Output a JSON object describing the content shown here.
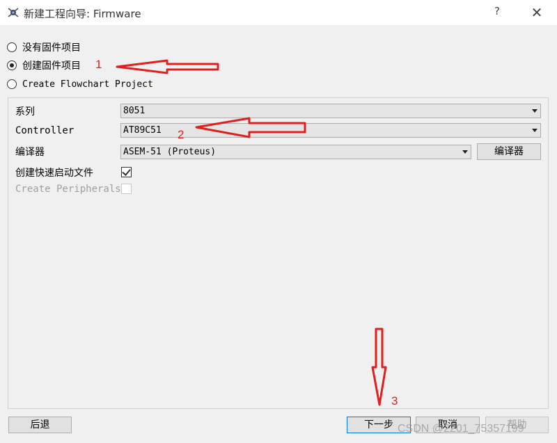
{
  "window": {
    "title": "新建工程向导: Firmware",
    "help": "?",
    "close": "✕"
  },
  "options": [
    {
      "label": "没有固件项目",
      "checked": false
    },
    {
      "label": "创建固件项目",
      "checked": true
    },
    {
      "label": "Create Flowchart Project",
      "checked": false
    }
  ],
  "form": {
    "family_label": "系列",
    "family_value": "8051",
    "controller_label": "Controller",
    "controller_value": "AT89C51",
    "compiler_label": "编译器",
    "compiler_value": "ASEM-51 (Proteus)",
    "compiler_button": "编译器",
    "quickstart_label": "创建快速启动文件",
    "quickstart_checked": true,
    "peripherals_label": "Create Peripherals",
    "peripherals_checked": false
  },
  "footer": {
    "back": "后退",
    "next": "下一步",
    "cancel": "取消",
    "help": "帮助"
  },
  "annotations": {
    "n1": "1",
    "n2": "2",
    "n3": "3",
    "color": "#e02020"
  },
  "watermark": "CSDN @2201_75357199"
}
